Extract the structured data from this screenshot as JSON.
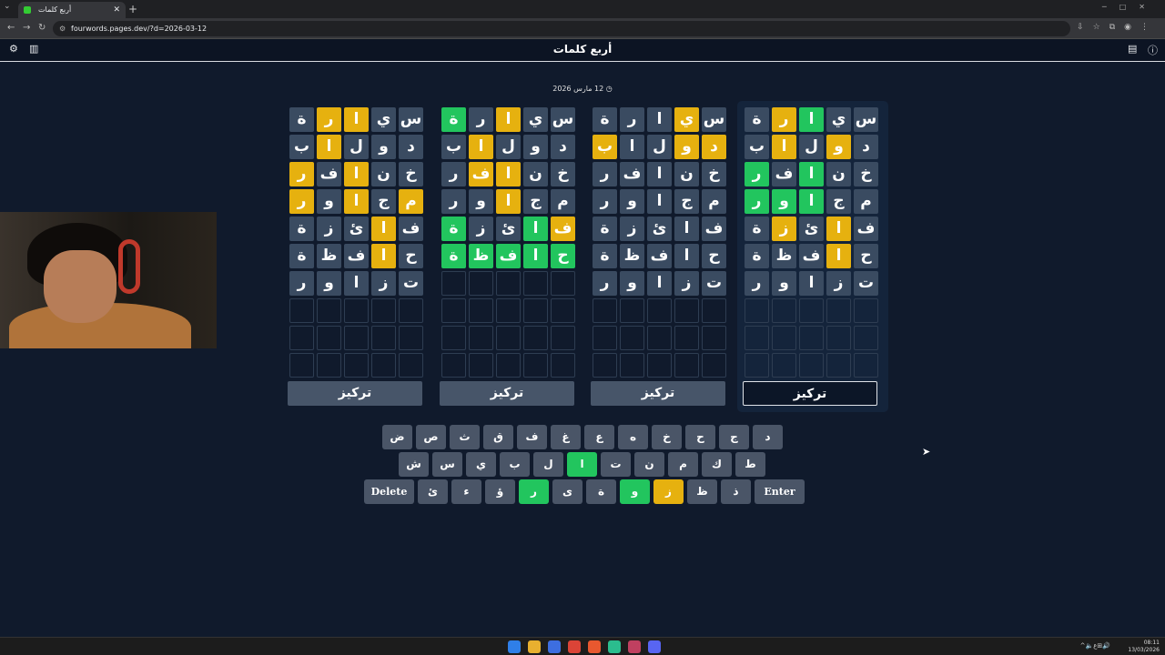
{
  "browser": {
    "tab_title": "أربع كلمات",
    "url": "fourwords.pages.dev/?d=2026-03-12"
  },
  "app": {
    "title": "أربع كلمات",
    "date": "12 مارس 2026"
  },
  "focus_label": "تركيز",
  "boards": [
    {
      "focused": false,
      "rows": [
        [
          [
            "س",
            "k"
          ],
          [
            "ي",
            "k"
          ],
          [
            "ا",
            "y"
          ],
          [
            "ر",
            "y"
          ],
          [
            "ة",
            "k"
          ]
        ],
        [
          [
            "د",
            "k"
          ],
          [
            "و",
            "k"
          ],
          [
            "ل",
            "k"
          ],
          [
            "ا",
            "y"
          ],
          [
            "ب",
            "k"
          ]
        ],
        [
          [
            "خ",
            "k"
          ],
          [
            "ن",
            "k"
          ],
          [
            "ا",
            "y"
          ],
          [
            "ف",
            "k"
          ],
          [
            "ر",
            "y"
          ]
        ],
        [
          [
            "م",
            "y"
          ],
          [
            "ج",
            "k"
          ],
          [
            "ا",
            "y"
          ],
          [
            "و",
            "k"
          ],
          [
            "ر",
            "y"
          ]
        ],
        [
          [
            "ف",
            "k"
          ],
          [
            "ا",
            "y"
          ],
          [
            "ئ",
            "k"
          ],
          [
            "ز",
            "k"
          ],
          [
            "ة",
            "k"
          ]
        ],
        [
          [
            "ح",
            "k"
          ],
          [
            "ا",
            "y"
          ],
          [
            "ف",
            "k"
          ],
          [
            "ظ",
            "k"
          ],
          [
            "ة",
            "k"
          ]
        ],
        [
          [
            "ت",
            "k"
          ],
          [
            "ز",
            "k"
          ],
          [
            "ا",
            "k"
          ],
          [
            "و",
            "k"
          ],
          [
            "ر",
            "k"
          ]
        ]
      ]
    },
    {
      "focused": false,
      "rows": [
        [
          [
            "س",
            "k"
          ],
          [
            "ي",
            "k"
          ],
          [
            "ا",
            "y"
          ],
          [
            "ر",
            "k"
          ],
          [
            "ة",
            "g"
          ]
        ],
        [
          [
            "د",
            "k"
          ],
          [
            "و",
            "k"
          ],
          [
            "ل",
            "k"
          ],
          [
            "ا",
            "y"
          ],
          [
            "ب",
            "k"
          ]
        ],
        [
          [
            "خ",
            "k"
          ],
          [
            "ن",
            "k"
          ],
          [
            "ا",
            "y"
          ],
          [
            "ف",
            "y"
          ],
          [
            "ر",
            "k"
          ]
        ],
        [
          [
            "م",
            "k"
          ],
          [
            "ج",
            "k"
          ],
          [
            "ا",
            "y"
          ],
          [
            "و",
            "k"
          ],
          [
            "ر",
            "k"
          ]
        ],
        [
          [
            "ف",
            "y"
          ],
          [
            "ا",
            "g"
          ],
          [
            "ئ",
            "k"
          ],
          [
            "ز",
            "k"
          ],
          [
            "ة",
            "g"
          ]
        ],
        [
          [
            "ح",
            "g"
          ],
          [
            "ا",
            "g"
          ],
          [
            "ف",
            "g"
          ],
          [
            "ظ",
            "g"
          ],
          [
            "ة",
            "g"
          ]
        ]
      ]
    },
    {
      "focused": false,
      "rows": [
        [
          [
            "س",
            "k"
          ],
          [
            "ي",
            "y"
          ],
          [
            "ا",
            "k"
          ],
          [
            "ر",
            "k"
          ],
          [
            "ة",
            "k"
          ]
        ],
        [
          [
            "د",
            "y"
          ],
          [
            "و",
            "y"
          ],
          [
            "ل",
            "k"
          ],
          [
            "ا",
            "k"
          ],
          [
            "ب",
            "y"
          ]
        ],
        [
          [
            "خ",
            "k"
          ],
          [
            "ن",
            "k"
          ],
          [
            "ا",
            "k"
          ],
          [
            "ف",
            "k"
          ],
          [
            "ر",
            "k"
          ]
        ],
        [
          [
            "م",
            "k"
          ],
          [
            "ج",
            "k"
          ],
          [
            "ا",
            "k"
          ],
          [
            "و",
            "k"
          ],
          [
            "ر",
            "k"
          ]
        ],
        [
          [
            "ف",
            "k"
          ],
          [
            "ا",
            "k"
          ],
          [
            "ئ",
            "k"
          ],
          [
            "ز",
            "k"
          ],
          [
            "ة",
            "k"
          ]
        ],
        [
          [
            "ح",
            "k"
          ],
          [
            "ا",
            "k"
          ],
          [
            "ف",
            "k"
          ],
          [
            "ظ",
            "k"
          ],
          [
            "ة",
            "k"
          ]
        ],
        [
          [
            "ت",
            "k"
          ],
          [
            "ز",
            "k"
          ],
          [
            "ا",
            "k"
          ],
          [
            "و",
            "k"
          ],
          [
            "ر",
            "k"
          ]
        ]
      ]
    },
    {
      "focused": true,
      "rows": [
        [
          [
            "س",
            "k"
          ],
          [
            "ي",
            "k"
          ],
          [
            "ا",
            "g"
          ],
          [
            "ر",
            "y"
          ],
          [
            "ة",
            "k"
          ]
        ],
        [
          [
            "د",
            "k"
          ],
          [
            "و",
            "y"
          ],
          [
            "ل",
            "k"
          ],
          [
            "ا",
            "y"
          ],
          [
            "ب",
            "k"
          ]
        ],
        [
          [
            "خ",
            "k"
          ],
          [
            "ن",
            "k"
          ],
          [
            "ا",
            "g"
          ],
          [
            "ف",
            "k"
          ],
          [
            "ر",
            "g"
          ]
        ],
        [
          [
            "م",
            "k"
          ],
          [
            "ج",
            "k"
          ],
          [
            "ا",
            "g"
          ],
          [
            "و",
            "g"
          ],
          [
            "ر",
            "g"
          ]
        ],
        [
          [
            "ف",
            "k"
          ],
          [
            "ا",
            "y"
          ],
          [
            "ئ",
            "k"
          ],
          [
            "ز",
            "y"
          ],
          [
            "ة",
            "k"
          ]
        ],
        [
          [
            "ح",
            "k"
          ],
          [
            "ا",
            "y"
          ],
          [
            "ف",
            "k"
          ],
          [
            "ظ",
            "k"
          ],
          [
            "ة",
            "k"
          ]
        ],
        [
          [
            "ت",
            "k"
          ],
          [
            "ز",
            "k"
          ],
          [
            "ا",
            "k"
          ],
          [
            "و",
            "k"
          ],
          [
            "ر",
            "k"
          ]
        ]
      ]
    }
  ],
  "keyboard": {
    "row1": [
      [
        "د",
        ""
      ],
      [
        "ج",
        ""
      ],
      [
        "ح",
        ""
      ],
      [
        "خ",
        ""
      ],
      [
        "ه",
        ""
      ],
      [
        "ع",
        ""
      ],
      [
        "غ",
        ""
      ],
      [
        "ف",
        ""
      ],
      [
        "ق",
        ""
      ],
      [
        "ث",
        ""
      ],
      [
        "ص",
        ""
      ],
      [
        "ض",
        ""
      ]
    ],
    "row2": [
      [
        "ط",
        ""
      ],
      [
        "ك",
        ""
      ],
      [
        "م",
        ""
      ],
      [
        "ن",
        ""
      ],
      [
        "ت",
        ""
      ],
      [
        "ا",
        "g"
      ],
      [
        "ل",
        ""
      ],
      [
        "ب",
        ""
      ],
      [
        "ي",
        ""
      ],
      [
        "س",
        ""
      ],
      [
        "ش",
        ""
      ]
    ],
    "row3": [
      [
        "Enter",
        "wide"
      ],
      [
        "ذ",
        ""
      ],
      [
        "ظ",
        ""
      ],
      [
        "ز",
        "y"
      ],
      [
        "و",
        "g"
      ],
      [
        "ة",
        ""
      ],
      [
        "ى",
        ""
      ],
      [
        "ر",
        "g"
      ],
      [
        "ؤ",
        ""
      ],
      [
        "ء",
        ""
      ],
      [
        "ئ",
        ""
      ],
      [
        "Delete",
        "wide"
      ]
    ]
  },
  "system": {
    "time": "08:11",
    "date": "13/03/2026"
  },
  "colors": {
    "correct": "#22c55e",
    "present": "#e6b10f",
    "absent": "#3a4b61",
    "background": "#101a2c"
  }
}
